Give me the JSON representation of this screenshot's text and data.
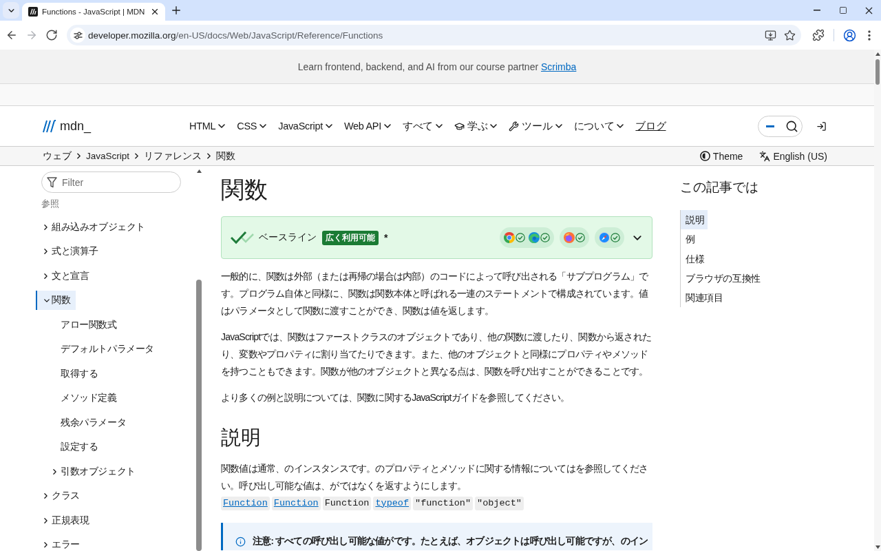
{
  "browser": {
    "tabs": [
      {
        "title": "Functions - JavaScript | MDN",
        "selected": true
      }
    ],
    "nav_buttons": [
      {
        "kind": "back",
        "disabled": false
      },
      {
        "kind": "forward",
        "disabled": true
      },
      {
        "kind": "reload",
        "disabled": false
      }
    ],
    "address": {
      "host": "developer.mozilla.org",
      "path": "/en-US/docs/Web/JavaScript/Reference/Functions"
    }
  },
  "banner": {
    "text": "Learn frontend, backend, and AI from our course partner",
    "link": "Scrimba"
  },
  "header": {
    "logo": "mdn_",
    "nav": [
      {
        "label": "HTML",
        "kind": "menu"
      },
      {
        "label": "CSS",
        "kind": "menu"
      },
      {
        "label": "JavaScript",
        "kind": "menu"
      },
      {
        "label": "Web API",
        "kind": "menu"
      },
      {
        "label": "すべて",
        "kind": "menu"
      },
      {
        "label": "学ぶ",
        "kind": "learn"
      },
      {
        "label": "ツール",
        "kind": "tools"
      },
      {
        "label": "について",
        "kind": "menu"
      },
      {
        "label": "ブログ",
        "kind": "link"
      }
    ]
  },
  "breadcrumb_bar": {
    "crumbs": [
      "ウェブ",
      "JavaScript",
      "リファレンス",
      "関数"
    ],
    "theme": "Theme",
    "language": "English (US)"
  },
  "sidebar": {
    "filter": {
      "placeholder": "Filter"
    },
    "section": "参照",
    "items": [
      {
        "label": "組み込みオブジェクト",
        "kind": "group",
        "expanded": false,
        "selected": false
      },
      {
        "label": "式と演算子",
        "kind": "group",
        "expanded": false,
        "selected": false
      },
      {
        "label": "文と宣言",
        "kind": "group",
        "expanded": false,
        "selected": false
      },
      {
        "label": "関数",
        "kind": "group",
        "expanded": true,
        "selected": true,
        "children": [
          {
            "label": "アロー関数式",
            "kind": "page",
            "selected": false
          },
          {
            "label": "デフォルトパラメータ",
            "kind": "page",
            "selected": false
          },
          {
            "label": "取得する",
            "kind": "page",
            "selected": false
          },
          {
            "label": "メソッド定義",
            "kind": "page",
            "selected": false
          },
          {
            "label": "残余パラメータ",
            "kind": "page",
            "selected": false
          },
          {
            "label": "設定する",
            "kind": "page",
            "selected": false
          },
          {
            "label": "引数オブジェクト",
            "kind": "group",
            "expanded": false,
            "selected": false
          }
        ]
      },
      {
        "label": "クラス",
        "kind": "group",
        "expanded": false,
        "selected": false
      },
      {
        "label": "正規表現",
        "kind": "group",
        "expanded": false,
        "selected": false
      },
      {
        "label": "エラー",
        "kind": "group",
        "expanded": false,
        "selected": false
      }
    ]
  },
  "article": {
    "title": "関数",
    "baseline": {
      "label": "ベースライン",
      "badge": "広く利用可能",
      "mark": "*",
      "expanded": false,
      "browser_groups": [
        {
          "browsers": [
            {
              "kind": "chrome",
              "supported": true
            },
            {
              "kind": "edge",
              "supported": true
            }
          ]
        },
        {
          "browsers": [
            {
              "kind": "firefox",
              "supported": true
            }
          ]
        },
        {
          "browsers": [
            {
              "kind": "safari",
              "supported": true
            }
          ]
        }
      ]
    },
    "intro": [
      "一般的に、関数は外部（または再帰の場合は内部）のコードによって呼び出される「サブプログラム」です。プログラム自体と同様に、関数は関数本体と呼ばれる一連のステートメントで構成されています。値はパラメータとして関数に渡すことができ、関数は値を返します。",
      "JavaScriptでは、関数はファーストクラスのオブジェクトであり、他の関数に渡したり、関数から返されたり、変数やプロパティに割り当てたりできます。また、他のオブジェクトと同様にプロパティやメソッドを持つこともできます。関数が他のオブジェクトと異なる点は、関数を呼び出すことができることです。",
      "より多くの例と説明については、関数に関するJavaScriptガイドを参照してください。"
    ],
    "sections": [
      {
        "heading": "説明",
        "paragraphs": [
          "関数値は通常、のインスタンスです。のプロパティとメソッドに関する情報についてはを参照してください。呼び出し可能な値は、がではなくを返すようにします。"
        ],
        "code_refs": [
          {
            "text": "Function",
            "linked": true
          },
          {
            "text": "Function",
            "linked": true
          },
          {
            "text": "Function",
            "linked": false
          },
          {
            "text": "typeof",
            "linked": true
          },
          {
            "text": "\"function\"",
            "linked": false
          },
          {
            "text": "\"object\"",
            "linked": false
          }
        ],
        "note": "注意: すべての呼び出し可能な値がです。たとえば、オブジェクトは呼び出し可能ですが、のイン"
      }
    ]
  },
  "toc": {
    "title": "この記事では",
    "items": [
      {
        "label": "説明",
        "selected": true
      },
      {
        "label": "例",
        "selected": false
      },
      {
        "label": "仕様",
        "selected": false
      },
      {
        "label": "ブラウザの互換性",
        "selected": false
      },
      {
        "label": "関連項目",
        "selected": false
      }
    ]
  }
}
